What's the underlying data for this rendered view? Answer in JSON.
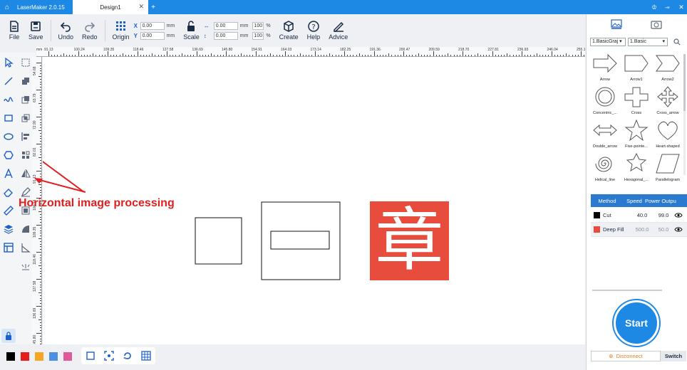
{
  "titlebar": {
    "app": "LaserMaker 2.0.15",
    "tab": "Design1",
    "home_icon": "home-icon",
    "close_icon": "close-icon",
    "add_icon": "plus-icon"
  },
  "toolbar": {
    "file": "File",
    "save": "Save",
    "undo": "Undo",
    "redo": "Redo",
    "origin": "Origin",
    "scale": "Scale",
    "create": "Create",
    "help": "Help",
    "advice": "Advice",
    "x_label": "X",
    "x_value": "0.00",
    "y_label": "Y",
    "y_value": "0.00",
    "unit_mm": "mm",
    "w_value": "0.00",
    "h_value": "0.00",
    "w_pct": "100",
    "h_pct": "100",
    "pct": "%"
  },
  "annotation": {
    "text": "Horizontal image processing",
    "color": "#e02020"
  },
  "canvas": {
    "stamp_char": "章",
    "stamp_color": "#e74c3c"
  },
  "ruler": {
    "h_labels": [
      "91.13",
      "100.24",
      "109.35",
      "118.46",
      "127.58",
      "136.69",
      "145.80",
      "154.91",
      "164.03",
      "173.14",
      "182.25",
      "191.36",
      "200.47",
      "209.59",
      "218.70",
      "227.81",
      "236.93",
      "246.04",
      "255.15"
    ],
    "v_labels": [
      "54.68",
      "63.79",
      "72.90",
      "82.01",
      "91.13",
      "100.24",
      "109.35",
      "118.46",
      "127.58",
      "136.69",
      "145.80"
    ],
    "unit": "mm"
  },
  "colors": [
    "#000000",
    "#e5201c",
    "#f5a623",
    "#4a90e2",
    "#e05a9a"
  ],
  "right": {
    "lib1": "1.BasicGraj",
    "lib2": "1.Basic",
    "shapes": [
      "Arrow",
      "Arrow1",
      "Arrow2",
      "Concentric_...",
      "Cross",
      "Cross_arrow",
      "Double_arrow",
      "Five-pointe...",
      "Heart-shaped",
      "Helical_line",
      "Hexagonal_...",
      "Parallelogram"
    ],
    "layer_headers": [
      "Method",
      "Speed",
      "Power Outpu"
    ],
    "layers": [
      {
        "color": "#000000",
        "method": "Cut",
        "speed": "40.0",
        "power": "99.0"
      },
      {
        "color": "#e74c3c",
        "method": "Deep Fill",
        "speed": "500.0",
        "power": "50.0"
      }
    ],
    "start": "Start",
    "disconnect": "Disconnect",
    "switch": "Switch"
  }
}
